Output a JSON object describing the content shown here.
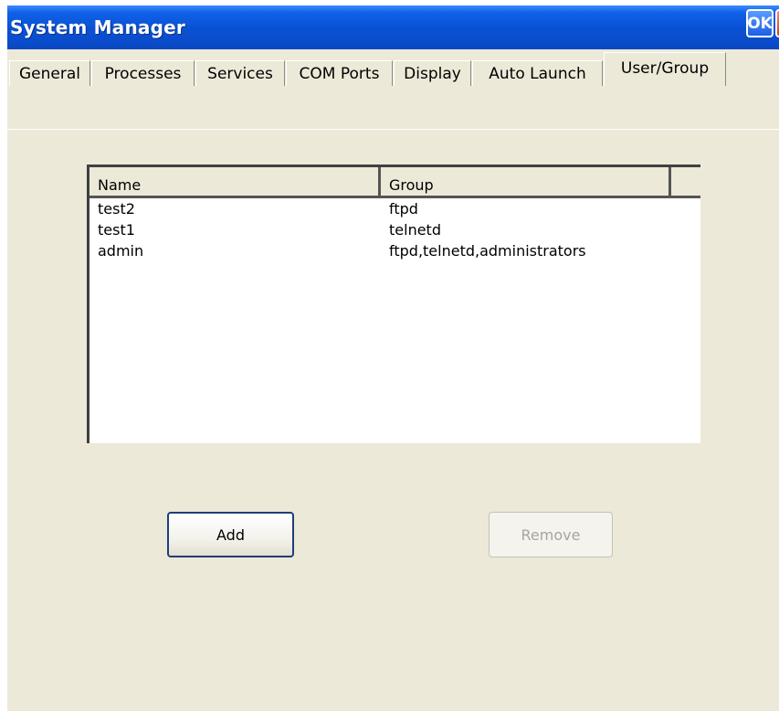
{
  "window": {
    "title": "System Manager",
    "ok_label": "OK",
    "close_label": "✕"
  },
  "tabs": [
    {
      "label": "General"
    },
    {
      "label": "Processes"
    },
    {
      "label": "Services"
    },
    {
      "label": "COM Ports"
    },
    {
      "label": "Display"
    },
    {
      "label": "Auto Launch"
    },
    {
      "label": "User/Group",
      "active": true
    }
  ],
  "list": {
    "columns": [
      "Name",
      "Group"
    ],
    "rows": [
      {
        "name": "test2",
        "group": "ftpd"
      },
      {
        "name": "test1",
        "group": "telnetd"
      },
      {
        "name": "admin",
        "group": "ftpd,telnetd,administrators"
      }
    ]
  },
  "buttons": {
    "add": "Add",
    "remove": "Remove"
  },
  "colors": {
    "titlebar": "#0a52d4",
    "dialog_bg": "#ece9d8",
    "close_red": "#d1401e"
  }
}
